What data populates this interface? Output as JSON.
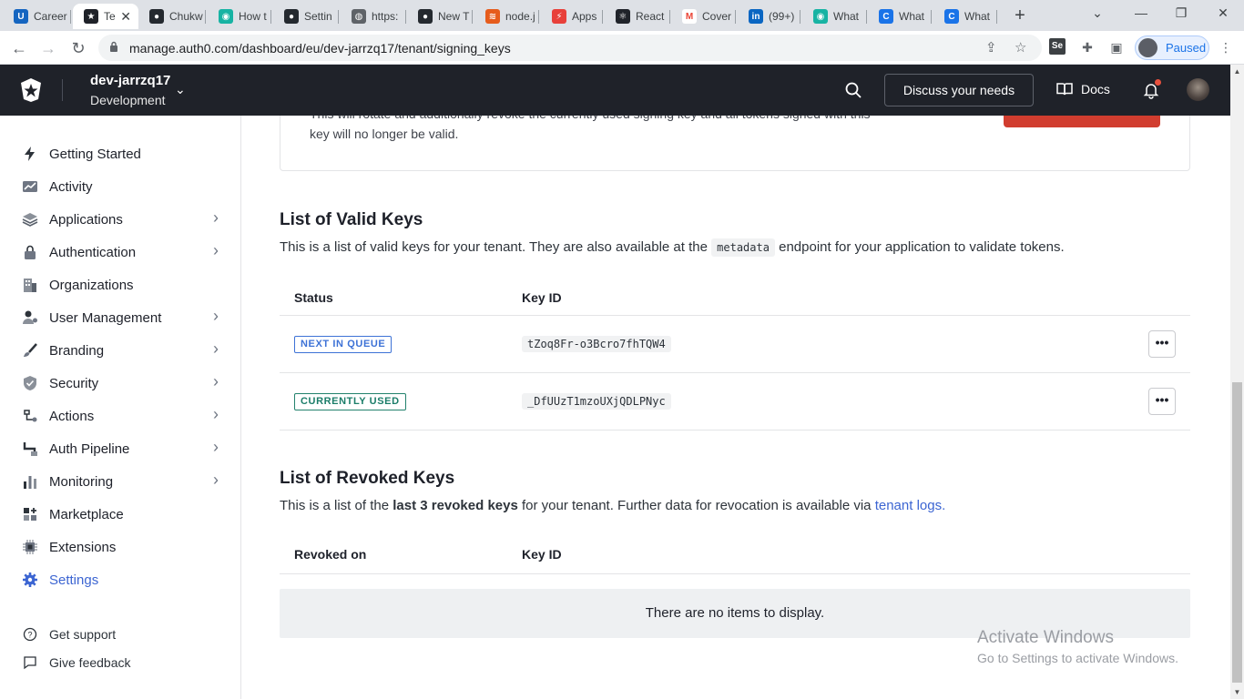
{
  "browser": {
    "tabs": [
      {
        "title": "Career",
        "color": "#1565c0",
        "glyph": "U"
      },
      {
        "title": "Te",
        "color": "#1f2229",
        "glyph": "★",
        "active": true
      },
      {
        "title": "Chukw",
        "color": "#24292f",
        "glyph": "●"
      },
      {
        "title": "How t",
        "color": "#17b3a3",
        "glyph": "◉"
      },
      {
        "title": "Settin",
        "color": "#24292f",
        "glyph": "●"
      },
      {
        "title": "https:",
        "color": "#5f6368",
        "glyph": "◍"
      },
      {
        "title": "New T",
        "color": "#24292f",
        "glyph": "●"
      },
      {
        "title": "node.j",
        "color": "#e65c1c",
        "glyph": "≋"
      },
      {
        "title": "Apps",
        "color": "#e8403a",
        "glyph": "⚡"
      },
      {
        "title": "React",
        "color": "#20232a",
        "glyph": "⚛"
      },
      {
        "title": "Cover",
        "color": "#ffffff",
        "glyph": "M"
      },
      {
        "title": "(99+)",
        "color": "#0a66c2",
        "glyph": "in"
      },
      {
        "title": "What",
        "color": "#17b3a3",
        "glyph": "◉"
      },
      {
        "title": "What",
        "color": "#1a73e8",
        "glyph": "C"
      },
      {
        "title": "What",
        "color": "#1a73e8",
        "glyph": "C"
      }
    ],
    "url": "manage.auth0.com/dashboard/eu/dev-jarrzq17/tenant/signing_keys",
    "profile_status": "Paused"
  },
  "header": {
    "tenant_name": "dev-jarrzq17",
    "tenant_env": "Development",
    "discuss_label": "Discuss your needs",
    "docs_label": "Docs"
  },
  "sidebar": {
    "items": [
      {
        "label": "Getting Started",
        "icon": "bolt-icon",
        "chevron": false
      },
      {
        "label": "Activity",
        "icon": "activity-icon",
        "chevron": false
      },
      {
        "label": "Applications",
        "icon": "layers-icon",
        "chevron": true
      },
      {
        "label": "Authentication",
        "icon": "lock-icon",
        "chevron": true
      },
      {
        "label": "Organizations",
        "icon": "building-icon",
        "chevron": false
      },
      {
        "label": "User Management",
        "icon": "user-gear-icon",
        "chevron": true
      },
      {
        "label": "Branding",
        "icon": "brush-icon",
        "chevron": true
      },
      {
        "label": "Security",
        "icon": "shield-icon",
        "chevron": true
      },
      {
        "label": "Actions",
        "icon": "actions-icon",
        "chevron": true
      },
      {
        "label": "Auth Pipeline",
        "icon": "pipeline-icon",
        "chevron": true
      },
      {
        "label": "Monitoring",
        "icon": "bar-chart-icon",
        "chevron": true
      },
      {
        "label": "Marketplace",
        "icon": "grid-plus-icon",
        "chevron": false
      },
      {
        "label": "Extensions",
        "icon": "chip-icon",
        "chevron": false
      },
      {
        "label": "Settings",
        "icon": "gear-icon",
        "chevron": false,
        "active": true
      }
    ],
    "footer": {
      "support_label": "Get support",
      "feedback_label": "Give feedback"
    }
  },
  "main": {
    "rotate_card": {
      "text_line1": "This will rotate and additionally revoke the currently used signing key and all tokens signed with this",
      "text_line2": "key will no longer be valid."
    },
    "valid_keys": {
      "title": "List of Valid Keys",
      "desc_before": "This is a list of valid keys for your tenant. They are also available at the",
      "desc_code": "metadata",
      "desc_after": "endpoint for your application to validate tokens.",
      "col_status": "Status",
      "col_key_id": "Key ID",
      "rows": [
        {
          "status": "NEXT IN QUEUE",
          "key_id": "tZoq8Fr-o3Bcro7fhTQW4"
        },
        {
          "status": "CURRENTLY USED",
          "key_id": "_DfUUzT1mzoUXjQDLPNyc"
        }
      ],
      "more_label": "•••"
    },
    "revoked_keys": {
      "title": "List of Revoked Keys",
      "desc_before": "This is a list of the",
      "desc_bold": "last 3 revoked keys",
      "desc_middle": "for your tenant. Further data for revocation is available via",
      "desc_link": "tenant logs.",
      "col_revoked_on": "Revoked on",
      "col_key_id": "Key ID",
      "empty_message": "There are no items to display."
    }
  },
  "watermark": {
    "line1": "Activate Windows",
    "line2": "Go to Settings to activate Windows."
  },
  "colors": {
    "header_bg": "#1f2229",
    "accent": "#3c65d2",
    "danger": "#d13d2f",
    "badge_blue": "#3d72d6",
    "badge_green": "#23826d"
  }
}
